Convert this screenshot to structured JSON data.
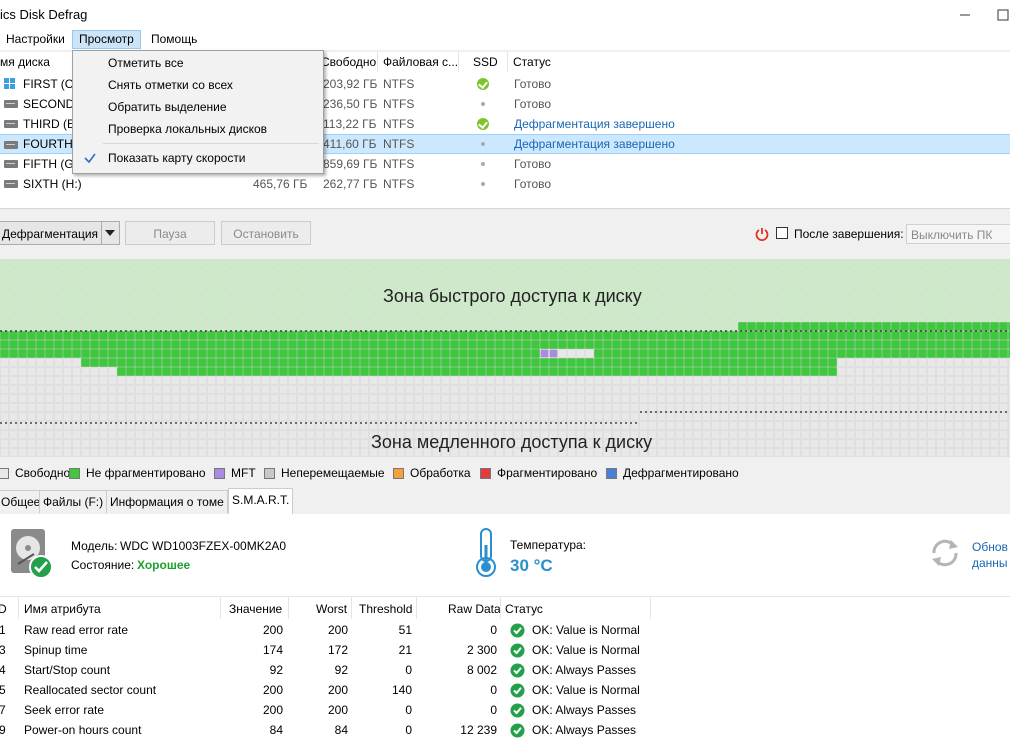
{
  "window": {
    "title": "ics Disk Defrag"
  },
  "menu": {
    "items": [
      "Настройки",
      "Просмотр",
      "Помощь"
    ]
  },
  "view_menu": {
    "items": [
      "Отметить все",
      "Снять отметки со всех",
      "Обратить выделение",
      "Проверка локальных дисков",
      "Показать карту скорости"
    ]
  },
  "disk_list": {
    "headers": {
      "name": "мя диска",
      "free": "Свободно",
      "fs": "Файловая с...",
      "ssd": "SSD",
      "status": "Статус"
    },
    "rows": [
      {
        "name": "FIRST (C:)",
        "size": "",
        "free": "203,92 ГБ",
        "fs": "NTFS",
        "ssd": "ok",
        "status": "Готово",
        "status_blue": false,
        "icon": "windows-drive-icon"
      },
      {
        "name": "SECOND",
        "size": "",
        "free": "236,50 ГБ",
        "fs": "NTFS",
        "ssd": "dot",
        "status": "Готово",
        "status_blue": false,
        "icon": "drive-icon"
      },
      {
        "name": "THIRD (E:",
        "size": "",
        "free": "113,22 ГБ",
        "fs": "NTFS",
        "ssd": "ok",
        "status": "Дефрагментация завершено",
        "status_blue": true,
        "icon": "drive-icon"
      },
      {
        "name": "FOURTH (",
        "size": "",
        "free": "411,60 ГБ",
        "fs": "NTFS",
        "ssd": "dot",
        "status": "Дефрагментация завершено",
        "status_blue": true,
        "icon": "drive-icon",
        "selected": true
      },
      {
        "name": "FIFTH (G:",
        "size": "",
        "free": "859,69 ГБ",
        "fs": "NTFS",
        "ssd": "dot",
        "status": "Готово",
        "status_blue": false,
        "icon": "drive-icon"
      },
      {
        "name": "SIXTH (H:)",
        "size": "465,76 ГБ",
        "free": "262,77 ГБ",
        "fs": "NTFS",
        "ssd": "dot",
        "status": "Готово",
        "status_blue": false,
        "icon": "drive-icon"
      }
    ]
  },
  "toolbar": {
    "action": "Дефрагментация",
    "pause": "Пауза",
    "stop": "Остановить",
    "after_label": "После завершения:",
    "after_value": "Выключить ПК"
  },
  "map": {
    "fast_zone": "Зона быстрого доступа к диску",
    "slow_zone": "Зона медленного доступа к диску"
  },
  "legend": [
    {
      "label": "Свободно",
      "color": "#e8e8e8"
    },
    {
      "label": "Не фрагментировано",
      "color": "#3ec83e"
    },
    {
      "label": "MFT",
      "color": "#a98be0"
    },
    {
      "label": "Неперемещаемые",
      "color": "#c8c8c8"
    },
    {
      "label": "Обработка",
      "color": "#f3a23a"
    },
    {
      "label": "Фрагментировано",
      "color": "#e03c3c"
    },
    {
      "label": "Дефрагментировано",
      "color": "#4a7fd6"
    }
  ],
  "tabs": [
    "Общее",
    "Файлы (F:)",
    "Информация о томе",
    "S.M.A.R.T."
  ],
  "smart": {
    "model_label": "Модель:",
    "model": "WDC WD1003FZEX-00MK2A0",
    "state_label": "Состояние:",
    "state": "Хорошее",
    "temp_label": "Температура:",
    "temp": "30 °C",
    "refresh_line1": "Обнов",
    "refresh_line2": "данны"
  },
  "smart_table": {
    "headers": [
      "D",
      "Имя атрибута",
      "Значение",
      "Worst",
      "Threshold",
      "Raw Data",
      "Статус"
    ],
    "rows": [
      {
        "id": "1",
        "name": "Raw read error rate",
        "value": "200",
        "worst": "200",
        "threshold": "51",
        "raw": "0",
        "status": "OK: Value is Normal"
      },
      {
        "id": "3",
        "name": "Spinup time",
        "value": "174",
        "worst": "172",
        "threshold": "21",
        "raw": "2 300",
        "status": "OK: Value is Normal"
      },
      {
        "id": "4",
        "name": "Start/Stop count",
        "value": "92",
        "worst": "92",
        "threshold": "0",
        "raw": "8 002",
        "status": "OK: Always Passes"
      },
      {
        "id": "5",
        "name": "Reallocated sector count",
        "value": "200",
        "worst": "200",
        "threshold": "140",
        "raw": "0",
        "status": "OK: Value is Normal"
      },
      {
        "id": "7",
        "name": "Seek error rate",
        "value": "200",
        "worst": "200",
        "threshold": "0",
        "raw": "0",
        "status": "OK: Always Passes"
      },
      {
        "id": "9",
        "name": "Power-on hours count",
        "value": "84",
        "worst": "84",
        "threshold": "0",
        "raw": "12 239",
        "status": "OK: Always Passes"
      }
    ]
  }
}
